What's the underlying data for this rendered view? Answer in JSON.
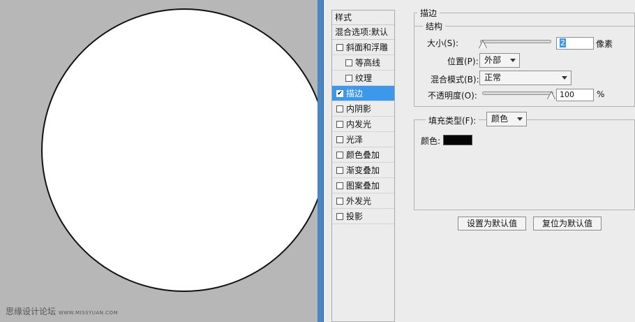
{
  "watermark": {
    "main": "思缘设计论坛",
    "url": "WWW.MISSYUAN.COM"
  },
  "style_list": {
    "header": "样式",
    "blend_options": "混合选项:默认",
    "items": [
      {
        "label": "斜面和浮雕",
        "checked": false,
        "sub": false,
        "selected": false
      },
      {
        "label": "等高线",
        "checked": false,
        "sub": true,
        "selected": false
      },
      {
        "label": "纹理",
        "checked": false,
        "sub": true,
        "selected": false
      },
      {
        "label": "描边",
        "checked": true,
        "sub": false,
        "selected": true
      },
      {
        "label": "内阴影",
        "checked": false,
        "sub": false,
        "selected": false
      },
      {
        "label": "内发光",
        "checked": false,
        "sub": false,
        "selected": false
      },
      {
        "label": "光泽",
        "checked": false,
        "sub": false,
        "selected": false
      },
      {
        "label": "颜色叠加",
        "checked": false,
        "sub": false,
        "selected": false
      },
      {
        "label": "渐变叠加",
        "checked": false,
        "sub": false,
        "selected": false
      },
      {
        "label": "图案叠加",
        "checked": false,
        "sub": false,
        "selected": false
      },
      {
        "label": "外发光",
        "checked": false,
        "sub": false,
        "selected": false
      },
      {
        "label": "投影",
        "checked": false,
        "sub": false,
        "selected": false
      }
    ]
  },
  "stroke": {
    "title": "描边",
    "structure": {
      "title": "结构",
      "size_label": "大小(S):",
      "size_value": "2",
      "size_unit": "像素",
      "size_slider": 0.008,
      "position_label": "位置(P):",
      "position_value": "外部",
      "blend_label": "混合模式(B):",
      "blend_value": "正常",
      "opacity_label": "不透明度(O):",
      "opacity_value": "100",
      "opacity_unit": "%",
      "opacity_slider": 1.0
    },
    "fill": {
      "type_label": "填充类型(F):",
      "type_value": "颜色",
      "color_label": "颜色:",
      "color_value": "#050505"
    }
  },
  "buttons": {
    "make_default": "设置为默认值",
    "reset_default": "复位为默认值"
  }
}
